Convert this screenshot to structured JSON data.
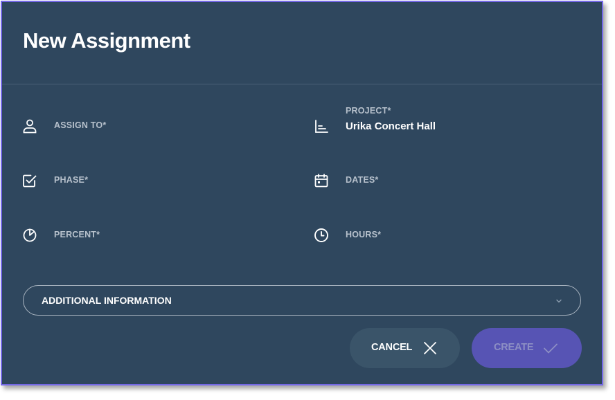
{
  "dialog": {
    "title": "New Assignment"
  },
  "fields": {
    "assign_to": {
      "label": "ASSIGN TO*",
      "icon": "person-icon"
    },
    "project": {
      "label": "PROJECT*",
      "value": "Urika Concert Hall",
      "icon": "project-chart-icon"
    },
    "phase": {
      "label": "PHASE*",
      "icon": "checkbox-icon"
    },
    "dates": {
      "label": "DATES*",
      "icon": "calendar-icon"
    },
    "percent": {
      "label": "PERCENT*",
      "icon": "pie-chart-icon"
    },
    "hours": {
      "label": "HOURS*",
      "icon": "clock-icon"
    }
  },
  "additional_info": {
    "label": "ADDITIONAL INFORMATION",
    "icon": "chevron-down-icon"
  },
  "buttons": {
    "cancel_label": "CANCEL",
    "create_label": "CREATE"
  },
  "colors": {
    "background": "#2f475e",
    "border": "#7468e6",
    "create_button": "#5754b4",
    "cancel_button": "#3a5469"
  }
}
